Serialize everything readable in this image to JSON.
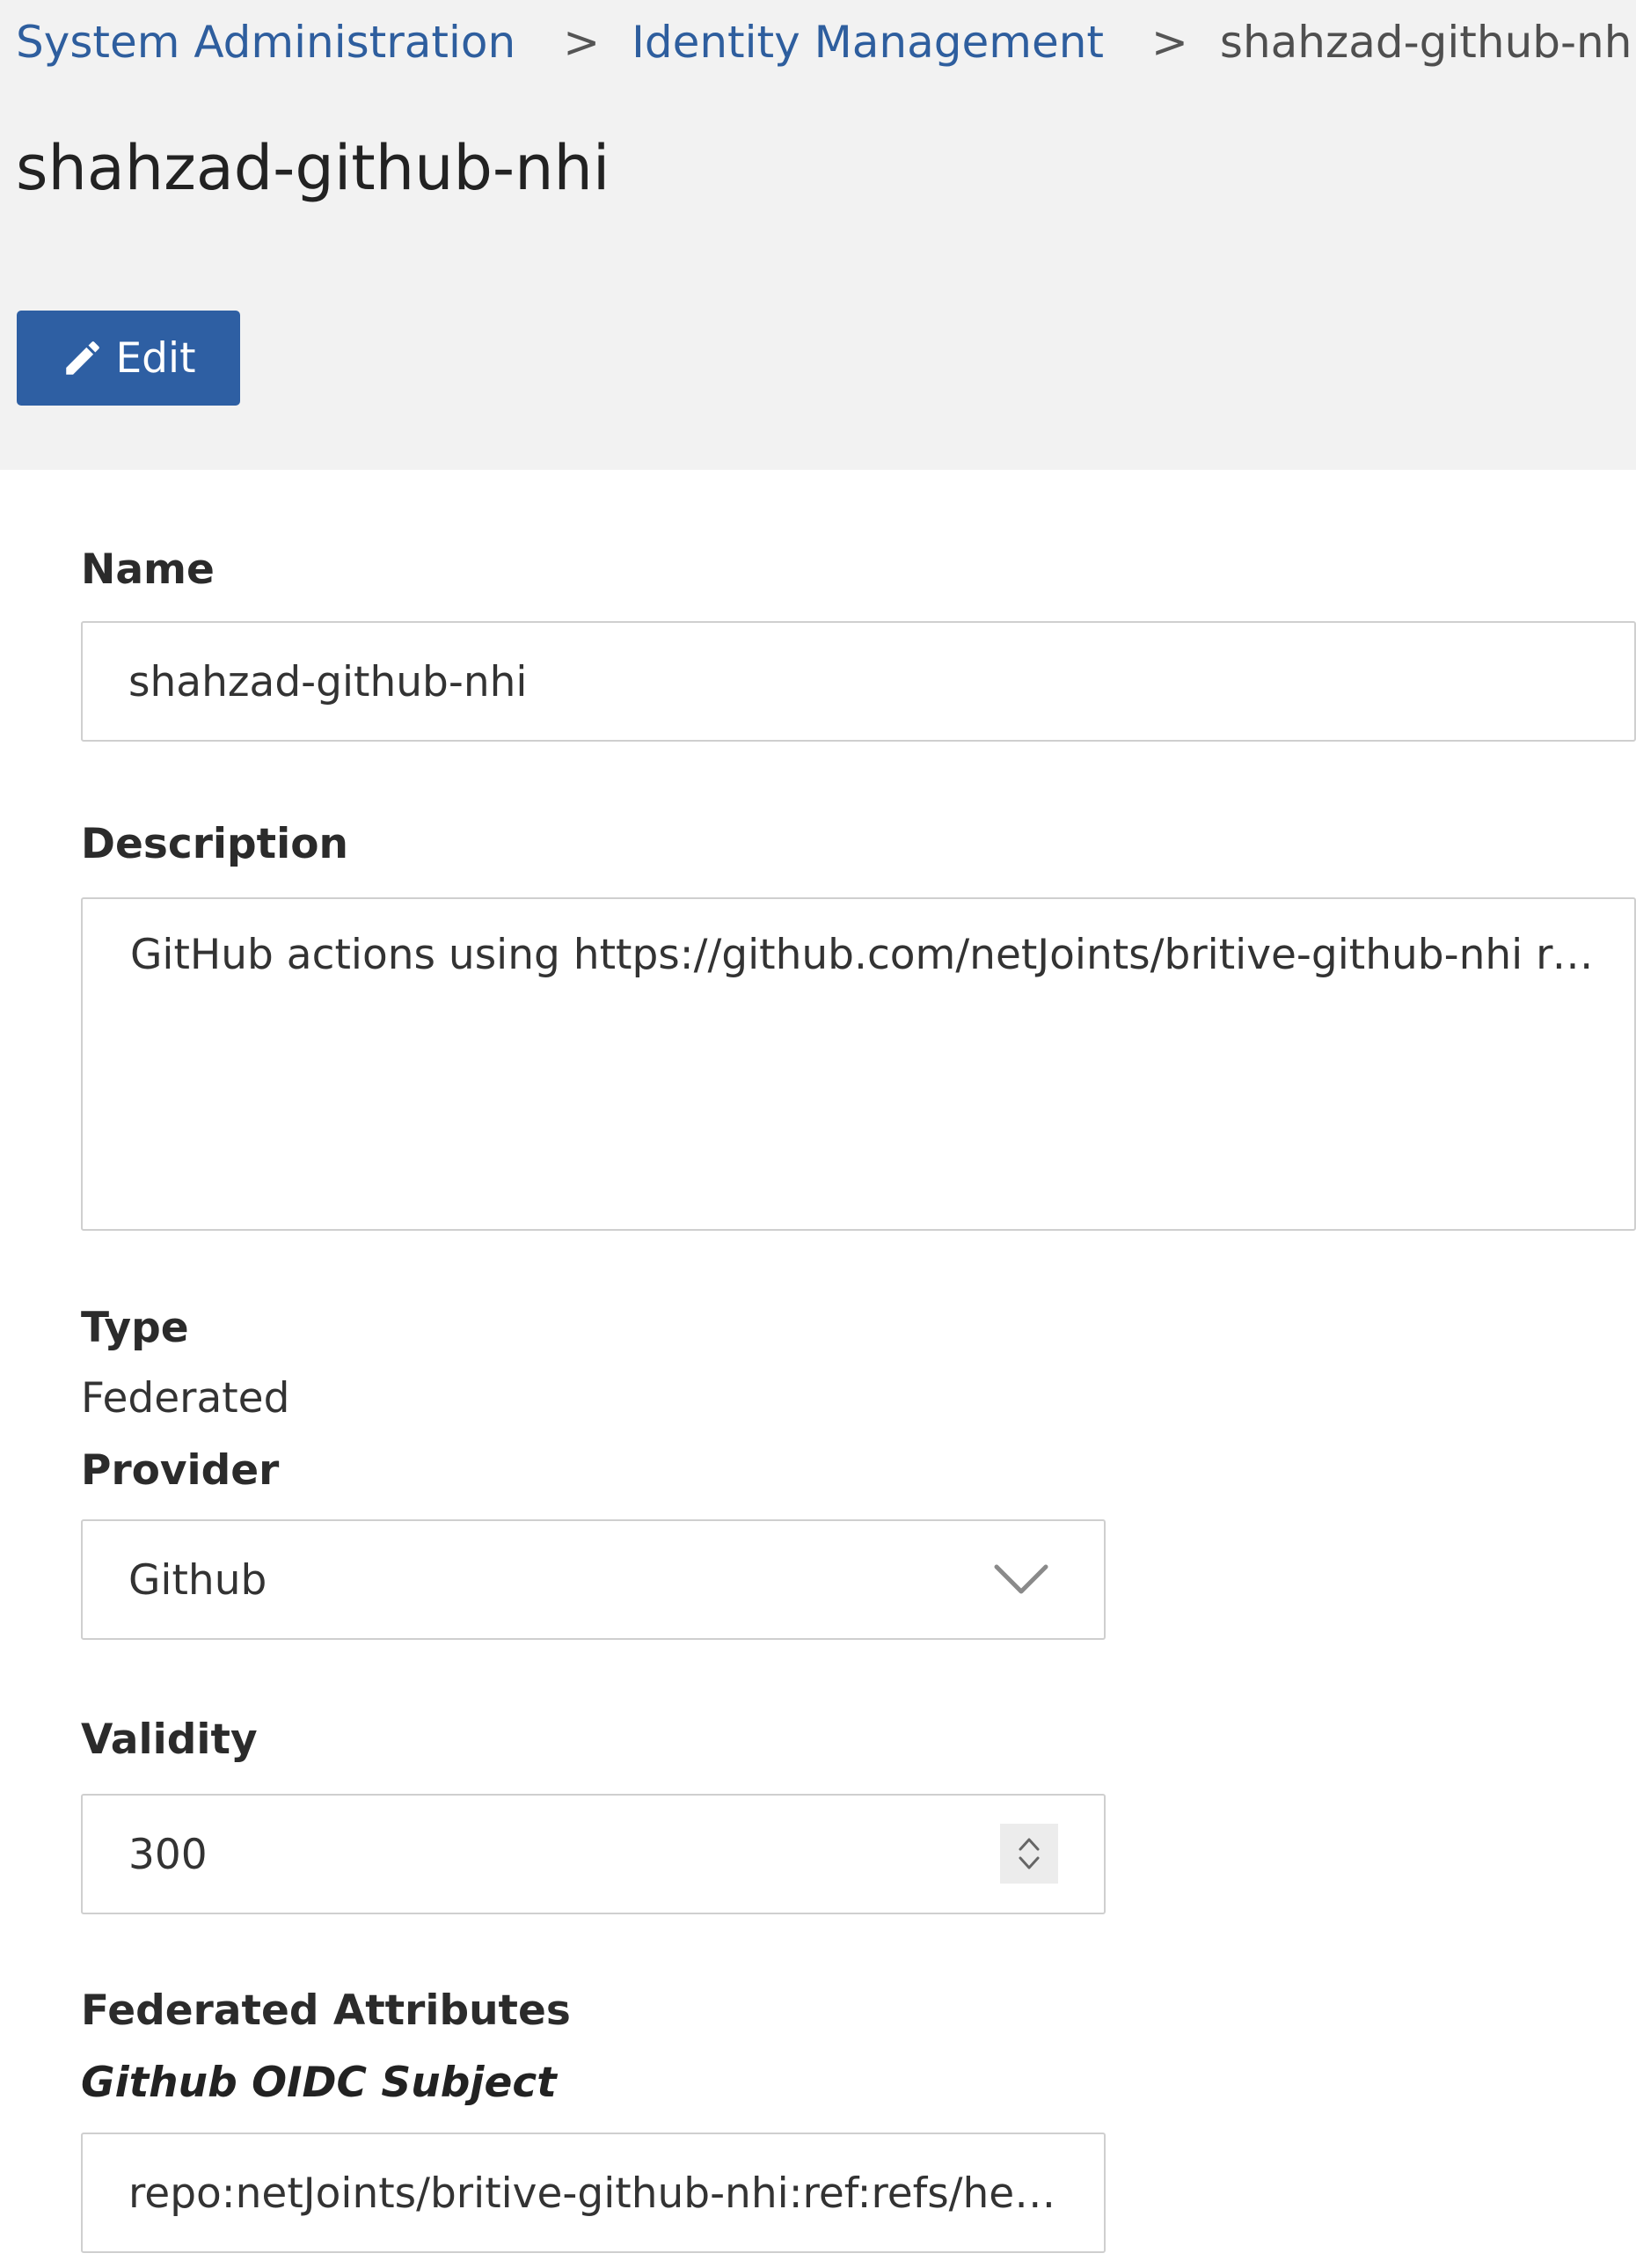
{
  "breadcrumb": {
    "items": [
      {
        "label": "System Administration"
      },
      {
        "label": "Identity Management"
      }
    ],
    "separator": ">",
    "current": "shahzad-github-nhi"
  },
  "page": {
    "title": "shahzad-github-nhi",
    "edit_label": "Edit"
  },
  "form": {
    "name": {
      "label": "Name",
      "value": "shahzad-github-nhi"
    },
    "description": {
      "label": "Description",
      "value": "GitHub actions using https://github.com/netJoints/britive-github-nhi repo"
    },
    "type": {
      "label": "Type",
      "value": "Federated"
    },
    "provider": {
      "label": "Provider",
      "selected": "Github"
    },
    "validity": {
      "label": "Validity",
      "value": "300"
    },
    "federated_attributes": {
      "label": "Federated Attributes",
      "subject_label": "Github OIDC Subject",
      "subject_value": "repo:netJoints/britive-github-nhi:ref:refs/head..."
    }
  },
  "colors": {
    "accent": "#2e5fa3",
    "link": "#2e5e9e",
    "header_bg": "#f2f2f2"
  },
  "icons": {
    "edit": "pencil-icon",
    "dropdown": "chevron-down-icon",
    "stepper": "up-down-stepper-icon"
  }
}
